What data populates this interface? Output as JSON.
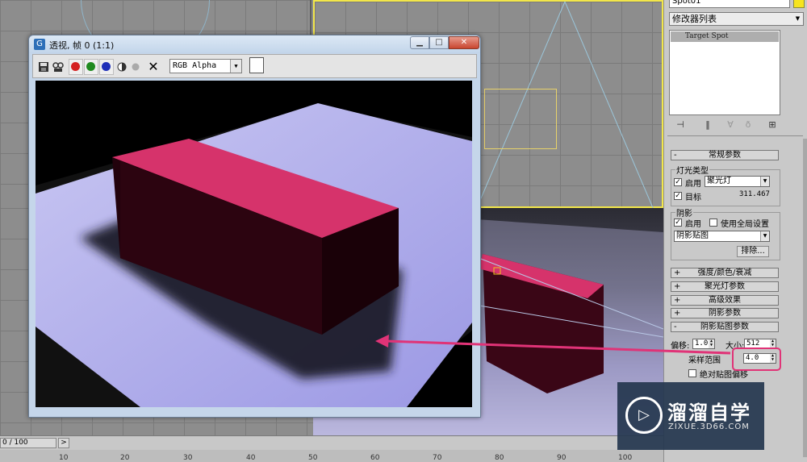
{
  "render_window": {
    "title": "透视, 帧 0 (1:1)",
    "app_icon": "G",
    "channel": "RGB Alpha",
    "buttons": {
      "minimize": "▁",
      "maximize": "□",
      "close": "✕"
    },
    "toolbar_icons": [
      "save-icon",
      "clone-icon",
      "red-channel-icon",
      "green-channel-icon",
      "blue-channel-icon",
      "alpha-channel-icon",
      "mono-icon",
      "clear-icon"
    ],
    "colors": {
      "red": "#d42020",
      "green": "#1f8a1f",
      "blue": "#1e2fb8"
    }
  },
  "command_panel": {
    "object_name": "Spot01",
    "object_color": "#f6e41f",
    "modifier_list": "修改器列表",
    "stack_item": "Target Spot",
    "rollouts": {
      "general": {
        "sign": "-",
        "label": "常规参数"
      },
      "intensity": {
        "sign": "+",
        "label": "强度/颜色/衰减"
      },
      "spotlight": {
        "sign": "+",
        "label": "聚光灯参数"
      },
      "advanced": {
        "sign": "+",
        "label": "高级效果"
      },
      "shadow_params": {
        "sign": "+",
        "label": "阴影参数"
      },
      "shadow_map": {
        "sign": "-",
        "label": "阴影贴图参数"
      }
    },
    "light_type": {
      "group": "灯光类型",
      "on_label": "启用",
      "type_value": "聚光灯",
      "target_label": "目标",
      "target_distance": "311.467"
    },
    "shadows": {
      "group": "阴影",
      "on_label": "启用",
      "global_label": "使用全局设置",
      "type_value": "阴影贴图",
      "exclude_button": "排除..."
    },
    "shadow_map": {
      "bias_label": "偏移:",
      "bias_value": "1.0",
      "size_label": "大小:",
      "size_value": "512",
      "sample_label": "采样范围",
      "sample_value": "4.0",
      "absolute_bias_label": "绝对贴图偏移"
    }
  },
  "timeline": {
    "frame_counter": "0 / 100",
    "next_button": ">",
    "ticks": [
      "10",
      "20",
      "30",
      "40",
      "50",
      "60",
      "70",
      "80",
      "90",
      "100"
    ]
  },
  "watermark": {
    "title": "溜溜自学",
    "url": "ZIXUE.3D66.COM"
  },
  "accent_colors": {
    "highlight": "#e03377",
    "box_top": "#d6336b",
    "box_side": "#3a0616",
    "floor": "#a9a6ee"
  }
}
